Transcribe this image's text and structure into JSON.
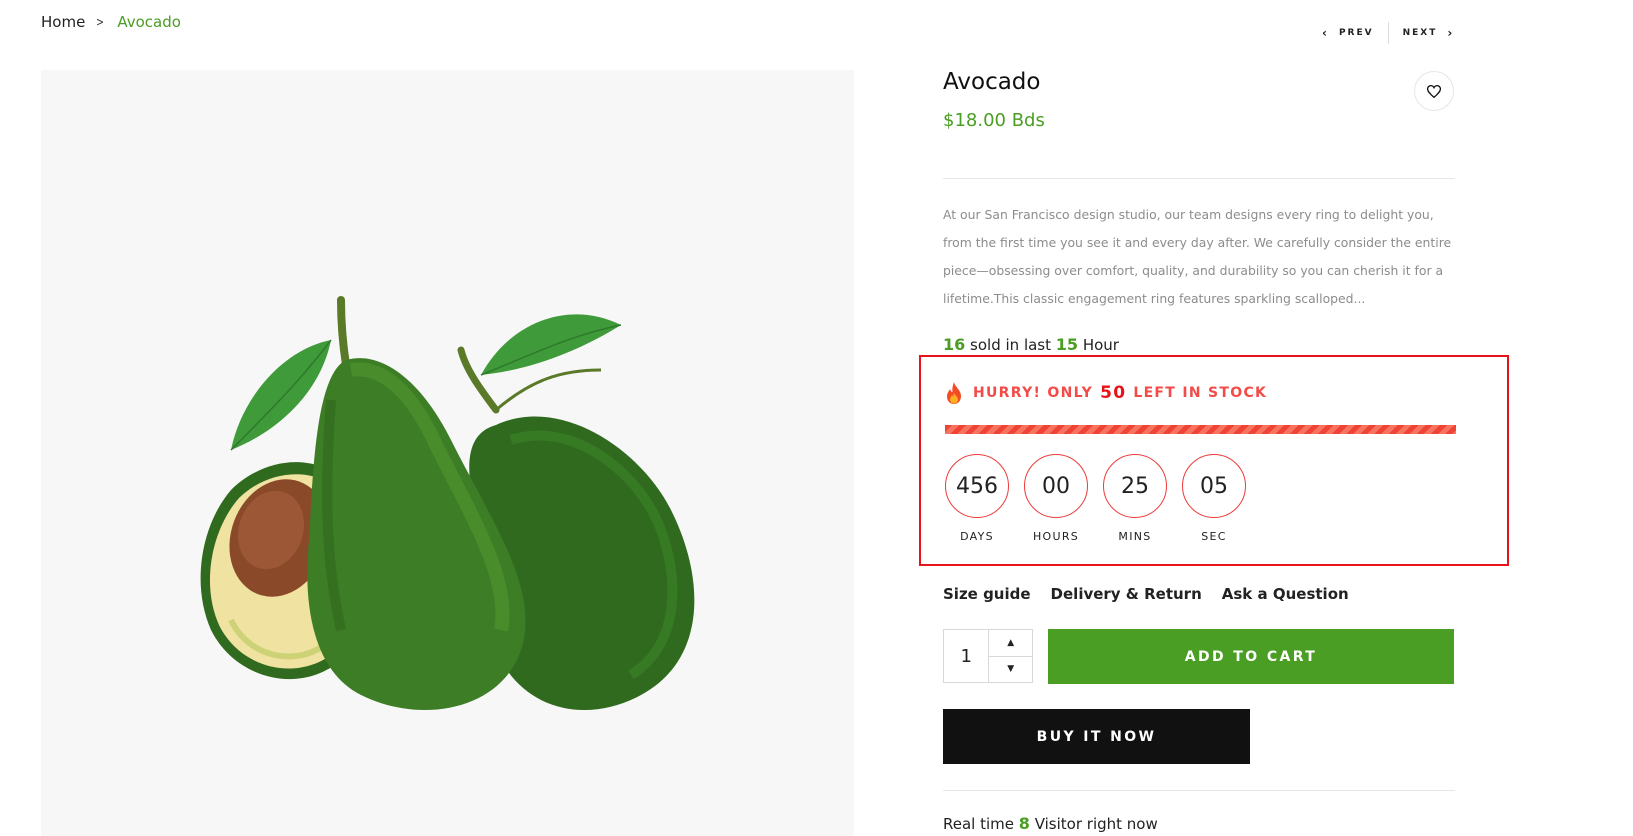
{
  "breadcrumb": {
    "home": "Home",
    "current": "Avocado"
  },
  "nav": {
    "prev": "PREV",
    "next": "NEXT"
  },
  "product": {
    "title": "Avocado",
    "price": "$18.00 Bds",
    "description": "At our San Francisco design studio, our team designs every ring to delight you, from the first time you see it and every day after. We carefully consider the entire piece—obsessing over comfort, quality, and durability so you can cherish it for a lifetime.This classic engagement ring features sparkling scalloped...",
    "image_alt": "Avocado"
  },
  "sold": {
    "count": "16",
    "middle": "sold in last",
    "hours": "15",
    "suffix": "Hour"
  },
  "stock": {
    "prefix": "HURRY! ONLY",
    "count": "50",
    "suffix": "LEFT IN STOCK",
    "bar_fill": 1.0
  },
  "countdown": [
    {
      "value": "456",
      "label": "DAYS"
    },
    {
      "value": "00",
      "label": "HOURS"
    },
    {
      "value": "25",
      "label": "MINS"
    },
    {
      "value": "05",
      "label": "SEC"
    }
  ],
  "links": {
    "size_guide": "Size guide",
    "delivery": "Delivery & Return",
    "ask": "Ask a Question"
  },
  "cart": {
    "quantity": "1",
    "add_to_cart": "ADD TO CART",
    "buy_now": "BUY IT NOW"
  },
  "visitors": {
    "prefix": "Real time",
    "count": "8",
    "suffix": "Visitor right now"
  },
  "colors": {
    "accent": "#4a9e23",
    "alert": "#e8121b",
    "dark": "#111111"
  }
}
